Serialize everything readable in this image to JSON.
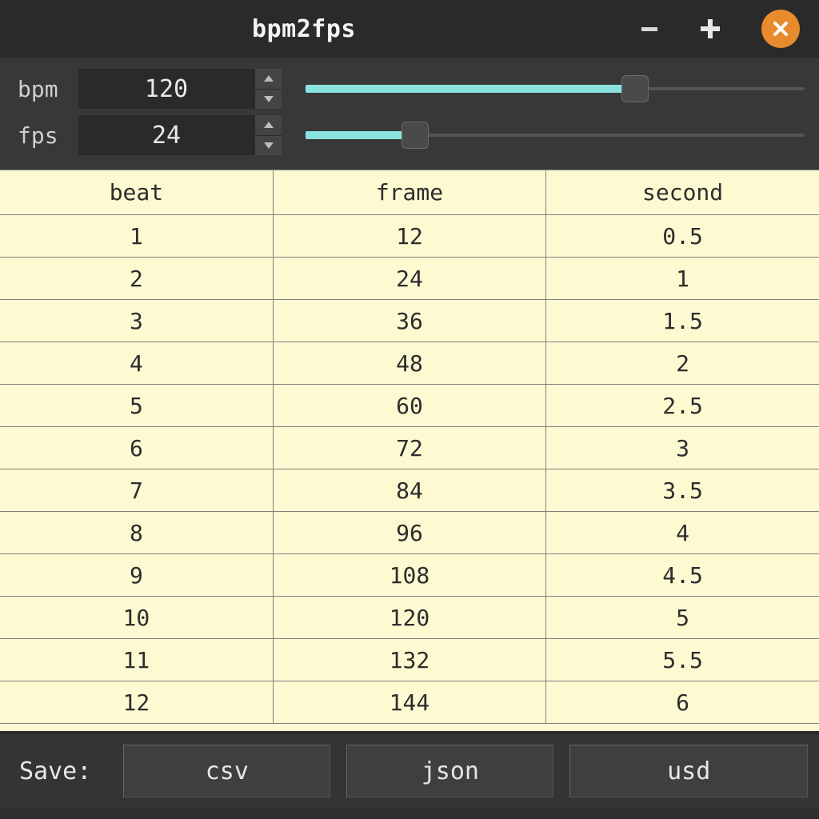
{
  "window": {
    "title": "bpm2fps"
  },
  "controls": {
    "bpm": {
      "label": "bpm",
      "value": "120",
      "slider_percent": 66
    },
    "fps": {
      "label": "fps",
      "value": "24",
      "slider_percent": 22
    }
  },
  "table": {
    "headers": [
      "beat",
      "frame",
      "second"
    ],
    "rows": [
      [
        "1",
        "12",
        "0.5"
      ],
      [
        "2",
        "24",
        "1"
      ],
      [
        "3",
        "36",
        "1.5"
      ],
      [
        "4",
        "48",
        "2"
      ],
      [
        "5",
        "60",
        "2.5"
      ],
      [
        "6",
        "72",
        "3"
      ],
      [
        "7",
        "84",
        "3.5"
      ],
      [
        "8",
        "96",
        "4"
      ],
      [
        "9",
        "108",
        "4.5"
      ],
      [
        "10",
        "120",
        "5"
      ],
      [
        "11",
        "132",
        "5.5"
      ],
      [
        "12",
        "144",
        "6"
      ]
    ]
  },
  "bottom": {
    "save_label": "Save:",
    "buttons": [
      "csv",
      "json",
      "usd"
    ]
  },
  "colors": {
    "accent": "#8ae3e1",
    "close": "#e78b2c",
    "table_bg": "#fdfad2",
    "chrome": "#383838"
  }
}
